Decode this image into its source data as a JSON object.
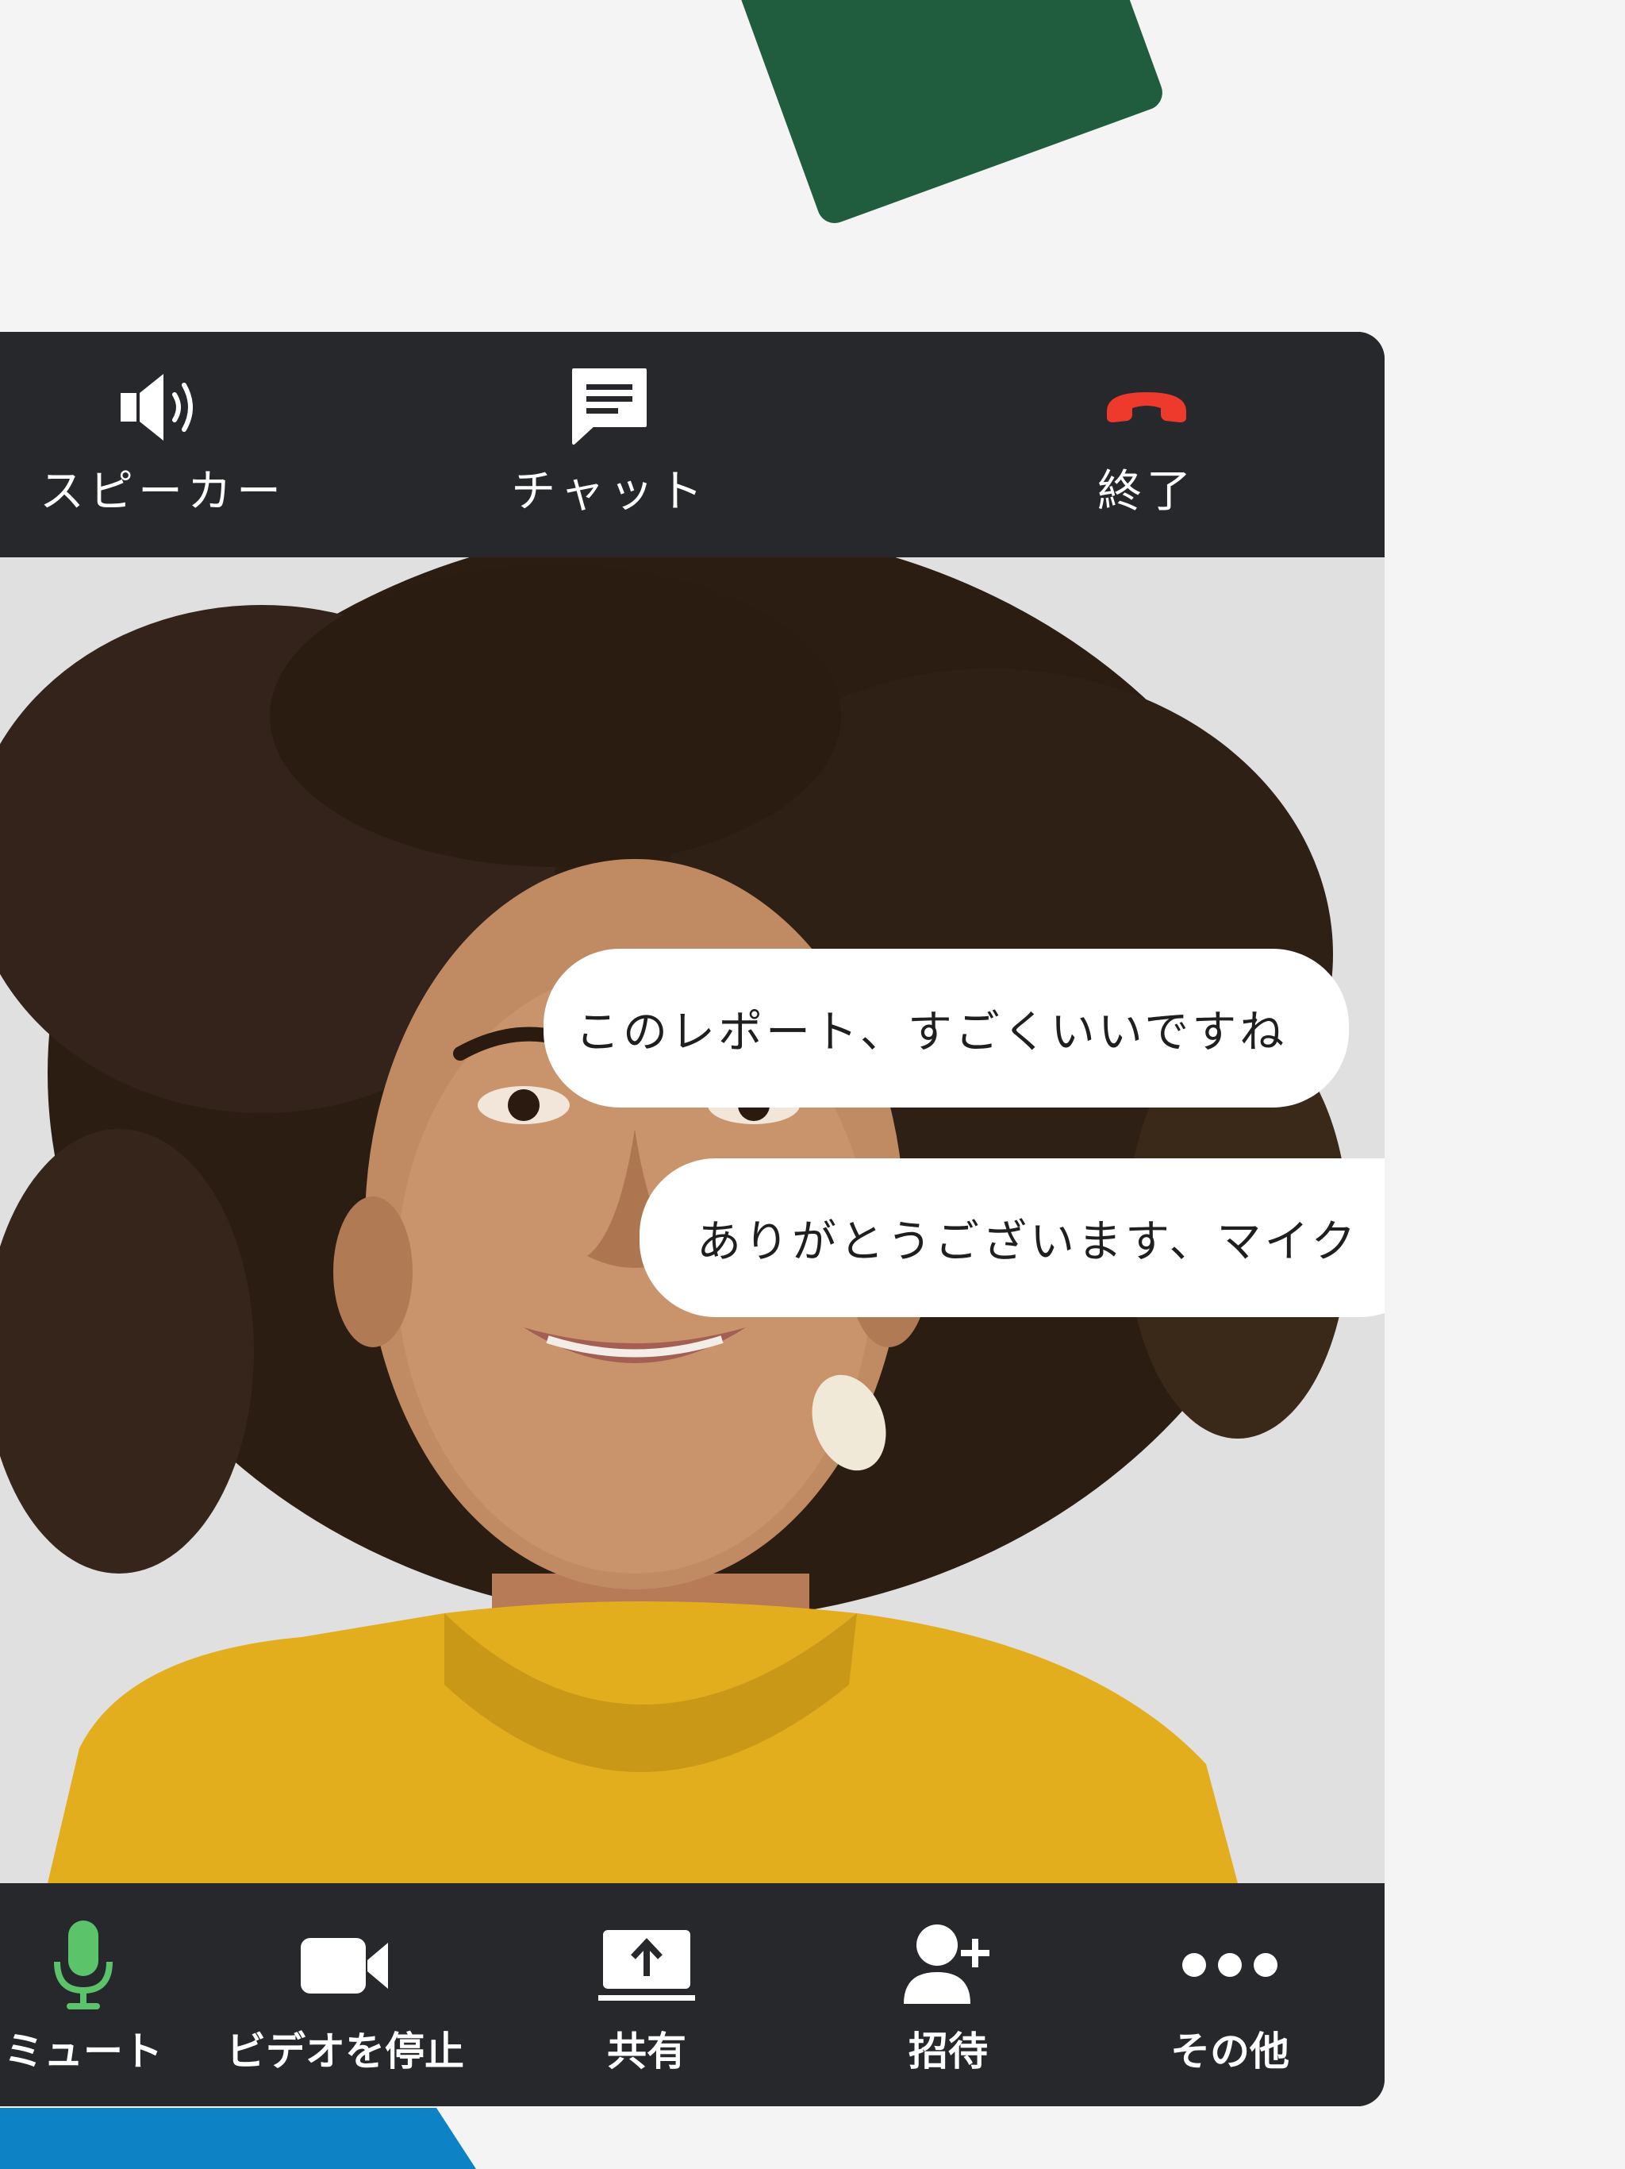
{
  "top_bar": {
    "speaker_label": "スピーカー",
    "chat_label": "チャット",
    "end_label": "終了"
  },
  "chat": {
    "messages": [
      {
        "text": "このレポート、すごくいいですね"
      },
      {
        "text": "ありがとうございます、マイク"
      }
    ]
  },
  "bottom_bar": {
    "mute_label": "ミュート",
    "stop_video_label": "ビデオを停止",
    "share_label": "共有",
    "invite_label": "招待",
    "more_label": "その他"
  },
  "icons": {
    "speaker": "speaker-icon",
    "chat": "chat-icon",
    "end_call": "phone-hangup-icon",
    "mute": "microphone-icon",
    "video": "video-camera-icon",
    "share": "share-screen-icon",
    "invite": "add-person-icon",
    "more": "more-dots-icon"
  },
  "colors": {
    "toolbar_bg": "#26282b",
    "end_call_red": "#ee3a2c",
    "mic_green": "#5bc46b",
    "deco_green": "#205d3f",
    "deco_blue": "#0d82c4",
    "sweater": "#e2ae1e"
  }
}
